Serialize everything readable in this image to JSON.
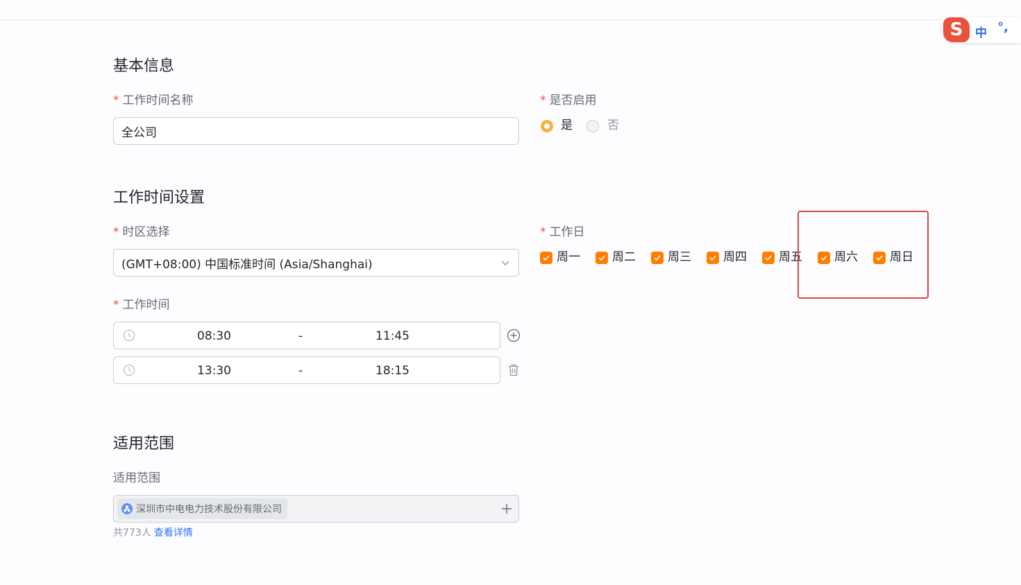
{
  "ime": {
    "logo_text": "S",
    "mode": "中",
    "punct": "°,"
  },
  "basic": {
    "title": "基本信息",
    "name_label": "工作时间名称",
    "name_value": "全公司",
    "enabled_label": "是否启用",
    "enabled_yes": "是",
    "enabled_no": "否",
    "enabled_selected": "是"
  },
  "worktime": {
    "title": "工作时间设置",
    "timezone_label": "时区选择",
    "timezone_value": "(GMT+08:00) 中国标准时间 (Asia/Shanghai)",
    "workdays_label": "工作日",
    "workdays": [
      {
        "label": "周一",
        "checked": true
      },
      {
        "label": "周二",
        "checked": true
      },
      {
        "label": "周三",
        "checked": true
      },
      {
        "label": "周四",
        "checked": true
      },
      {
        "label": "周五",
        "checked": true
      },
      {
        "label": "周六",
        "checked": true
      },
      {
        "label": "周日",
        "checked": true
      }
    ],
    "hours_label": "工作时间",
    "ranges": [
      {
        "start": "08:30",
        "sep": "-",
        "end": "11:45",
        "action": "plus-circle-icon"
      },
      {
        "start": "13:30",
        "sep": "-",
        "end": "18:15",
        "action": "trash-icon"
      }
    ]
  },
  "scope": {
    "title": "适用范围",
    "label": "适用范围",
    "tag": "深圳市中电电力技术股份有限公司",
    "count_text": "共773人",
    "details_link": "查看详情"
  },
  "colors": {
    "accent": "#ff7d00",
    "required": "#f54a45",
    "link": "#3370ff",
    "highlight": "#d64541"
  }
}
